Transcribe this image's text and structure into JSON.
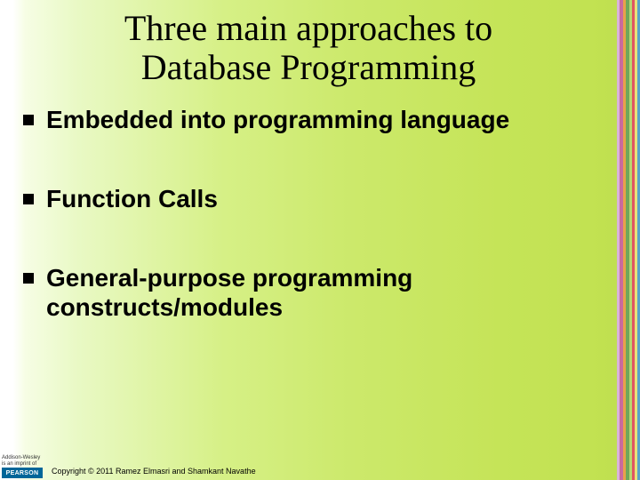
{
  "title_line1": "Three main approaches to",
  "title_line2": "Database Programming",
  "bullets": [
    "Embedded into programming language",
    "Function Calls",
    "General-purpose programming constructs/modules"
  ],
  "publisher_small_line1": "Addison-Wesley",
  "publisher_small_line2": "is an imprint of",
  "publisher_logo": "PEARSON",
  "copyright": "Copyright © 2011 Ramez Elmasri and Shamkant Navathe"
}
